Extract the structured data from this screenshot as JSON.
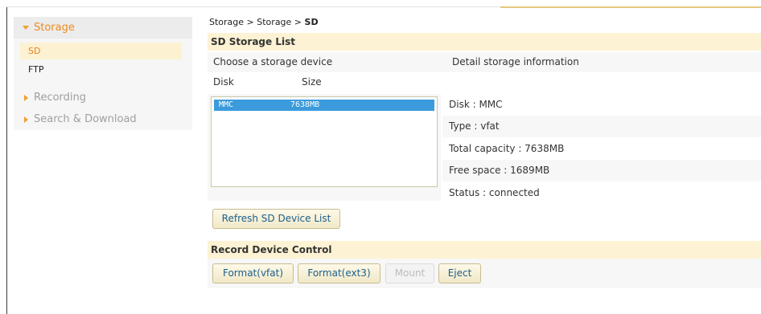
{
  "sidebar": {
    "storage_label": "Storage",
    "items": [
      {
        "label": "SD"
      },
      {
        "label": "FTP"
      }
    ],
    "groups": [
      {
        "label": "Recording"
      },
      {
        "label": "Search & Download"
      }
    ]
  },
  "breadcrumb": {
    "part1": "Storage",
    "sep": " > ",
    "part2": "Storage",
    "current": "SD"
  },
  "sd_list": {
    "title": "SD Storage List",
    "choose_label": "Choose a storage device",
    "detail_label": "Detail storage information",
    "col_disk": "Disk",
    "col_size": "Size",
    "devices": [
      {
        "disk": "MMC",
        "size": "7638MB"
      }
    ],
    "details": {
      "disk": "Disk : MMC",
      "type": "Type : vfat",
      "total": "Total capacity : 7638MB",
      "free": "Free space : 1689MB",
      "status": "Status : connected"
    },
    "refresh_button": "Refresh SD Device List"
  },
  "record_control": {
    "title": "Record Device Control",
    "format_vfat": "Format(vfat)",
    "format_ext3": "Format(ext3)",
    "mount": "Mount",
    "eject": "Eject"
  },
  "colors": {
    "accent": "#ef8a1d",
    "section_header_bg": "#fdf2d3",
    "selected_row": "#3b9bdc"
  }
}
